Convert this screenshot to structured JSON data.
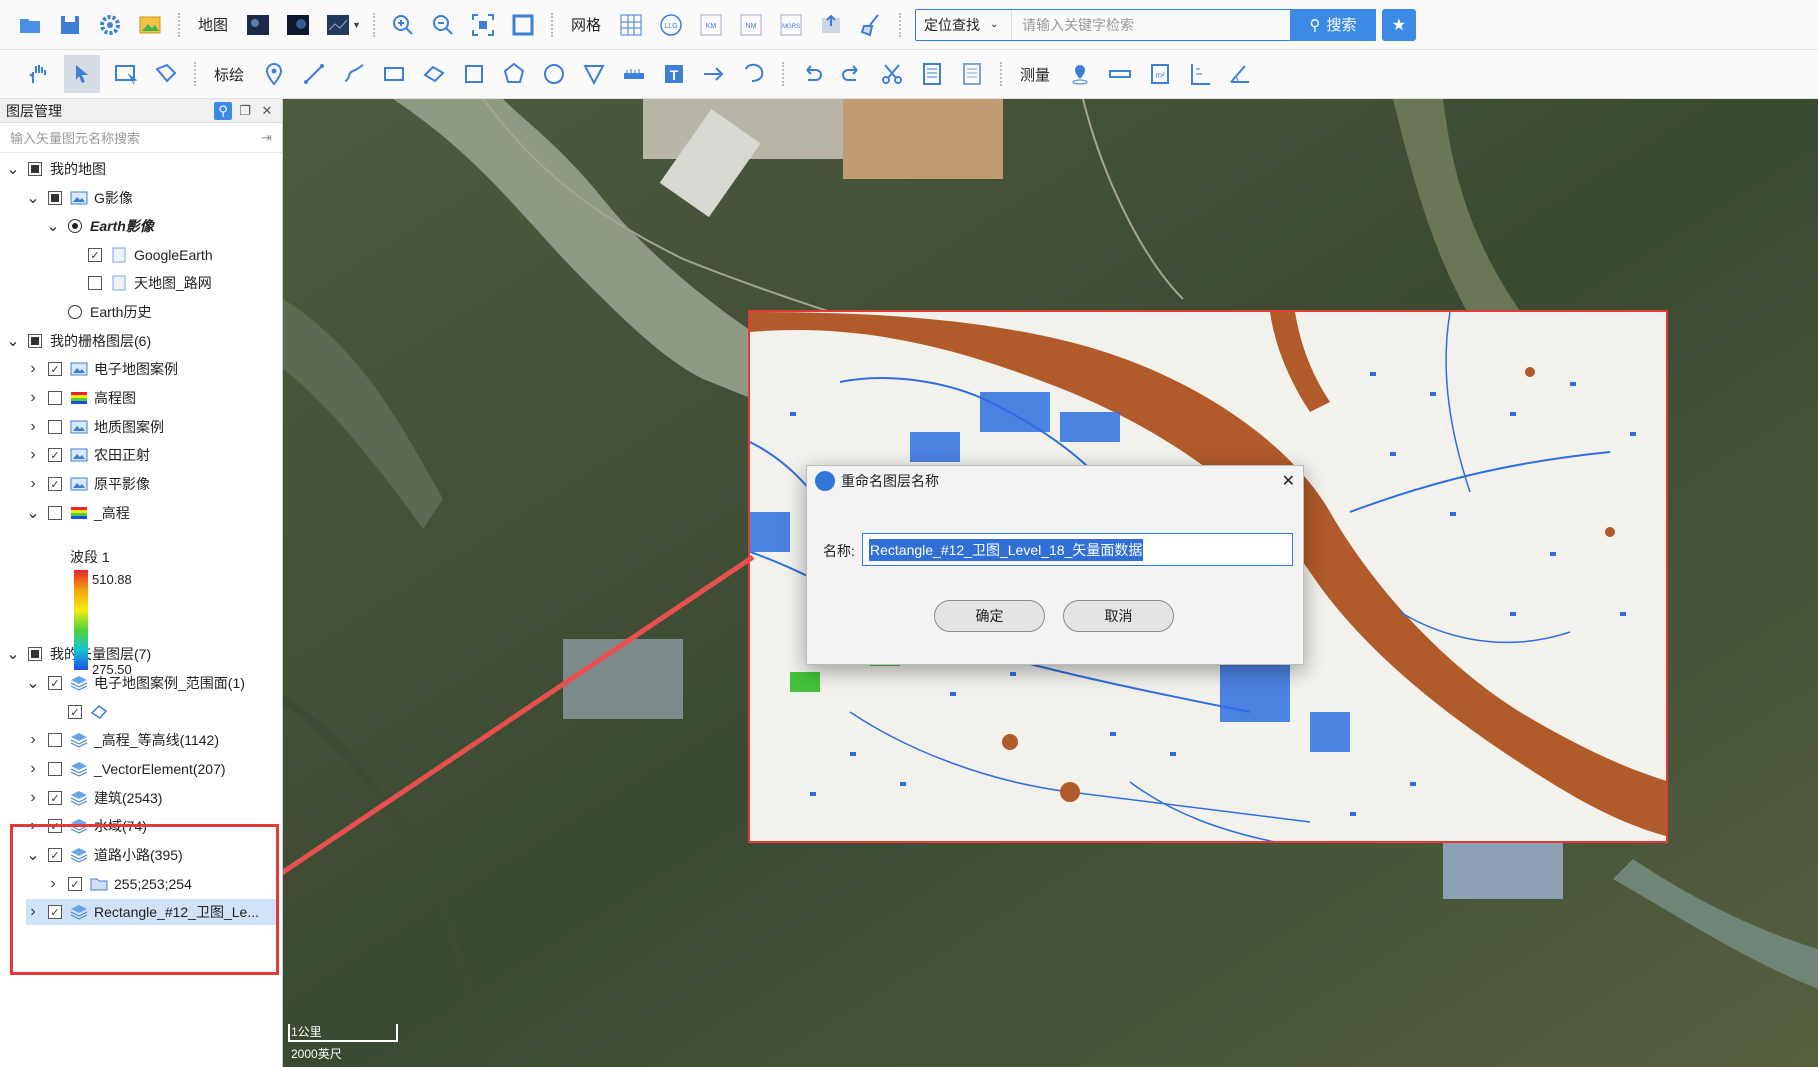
{
  "toolbar1": {
    "map_label": "地图",
    "grid_label": "网格",
    "grid_buttons": [
      "LLG",
      "KM",
      "NM",
      "MGRS"
    ],
    "search_mode": "定位查找",
    "search_placeholder": "请输入关键字检索",
    "search_button": "搜索"
  },
  "toolbar2": {
    "draw_label": "标绘",
    "measure_label": "测量"
  },
  "panel": {
    "title": "图层管理",
    "search_placeholder": "输入矢量图元名称搜索",
    "tree": [
      {
        "label": "我的地图",
        "level": 0,
        "expander": "v",
        "control": "filled"
      },
      {
        "label": "G影像",
        "level": 1,
        "expander": "v",
        "control": "filled",
        "icon": "raster"
      },
      {
        "label": "Earth影像",
        "level": 2,
        "expander": "v",
        "control": "radio-on"
      },
      {
        "label": "GoogleEarth",
        "level": 3,
        "expander": "",
        "control": "checked",
        "icon": "page"
      },
      {
        "label": "天地图_路网",
        "level": 3,
        "expander": "",
        "control": "unchecked",
        "icon": "page"
      },
      {
        "label": "Earth历史",
        "level": 2,
        "expander": "",
        "control": "radio-off"
      },
      {
        "label": "我的栅格图层(6)",
        "level": 0,
        "expander": "v",
        "control": "filled"
      },
      {
        "label": "电子地图案例",
        "level": 1,
        "expander": ">",
        "control": "checked",
        "icon": "raster"
      },
      {
        "label": "高程图",
        "level": 1,
        "expander": ">",
        "control": "unchecked",
        "icon": "rainbow"
      },
      {
        "label": "地质图案例",
        "level": 1,
        "expander": ">",
        "control": "unchecked",
        "icon": "raster"
      },
      {
        "label": "农田正射",
        "level": 1,
        "expander": ">",
        "control": "checked",
        "icon": "raster"
      },
      {
        "label": "原平影像",
        "level": 1,
        "expander": ">",
        "control": "checked",
        "icon": "raster"
      },
      {
        "label": "_高程",
        "level": 1,
        "expander": "v",
        "control": "unchecked",
        "icon": "rainbow"
      },
      {
        "label": "我的矢量图层(7)",
        "level": 0,
        "expander": "v",
        "control": "filled"
      },
      {
        "label": "电子地图案例_范围面(1)",
        "level": 1,
        "expander": "v",
        "control": "checked",
        "icon": "vector"
      },
      {
        "label": "",
        "level": 2,
        "expander": "",
        "control": "checked",
        "icon": "polygon"
      },
      {
        "label": "_高程_等高线(1142)",
        "level": 1,
        "expander": ">",
        "control": "unchecked",
        "icon": "vector"
      },
      {
        "label": "_VectorElement(207)",
        "level": 1,
        "expander": ">",
        "control": "unchecked",
        "icon": "vector"
      },
      {
        "label": "建筑(2543)",
        "level": 1,
        "expander": ">",
        "control": "checked",
        "icon": "vector"
      },
      {
        "label": "水域(74)",
        "level": 1,
        "expander": ">",
        "control": "checked",
        "icon": "vector"
      },
      {
        "label": "道路小路(395)",
        "level": 1,
        "expander": "v",
        "control": "checked",
        "icon": "vector"
      },
      {
        "label": "255;253;254",
        "level": 2,
        "expander": ">",
        "control": "checked",
        "icon": "folder"
      },
      {
        "label": "Rectangle_#12_卫图_Le...",
        "level": 1,
        "expander": ">",
        "control": "checked",
        "icon": "vector",
        "selected": true
      }
    ],
    "legend": {
      "band": "波段 1",
      "max": "510.88",
      "min": "275.50"
    }
  },
  "dialog": {
    "title": "重命名图层名称",
    "name_label": "名称:",
    "name_value": "Rectangle_#12_卫图_Level_18_矢量面数据",
    "ok": "确定",
    "cancel": "取消"
  },
  "scale": {
    "km": "1公里",
    "ft": "2000英尺"
  },
  "colors": {
    "accent": "#3b8ae6",
    "highlight": "#e53935",
    "river": "#b15a2a",
    "roads": "#2e6fe0"
  }
}
